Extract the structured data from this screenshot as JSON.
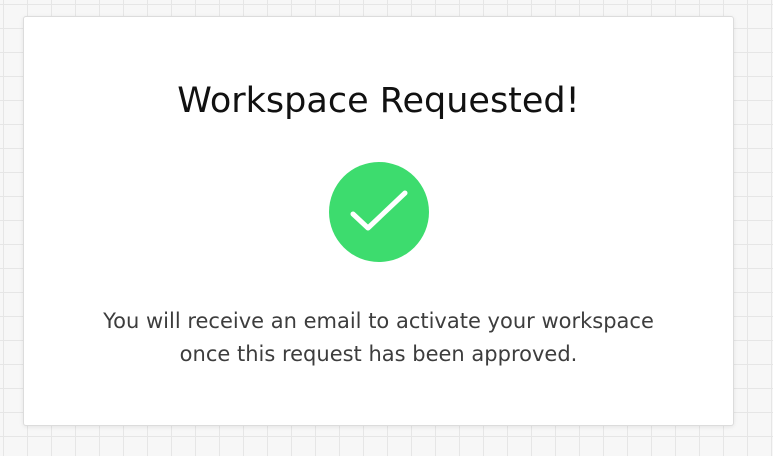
{
  "dialog": {
    "title": "Workspace Requested!",
    "status_icon": "check-circle-icon",
    "message_lines": [
      "You will receive an email to activate your workspace",
      "once this request has been approved."
    ]
  },
  "colors": {
    "success": "#3ddc6e",
    "check_mark": "#ffffff",
    "title_text": "#111111",
    "body_text": "#3d3d3d",
    "card_background": "#ffffff",
    "page_background": "#f7f7f7"
  }
}
